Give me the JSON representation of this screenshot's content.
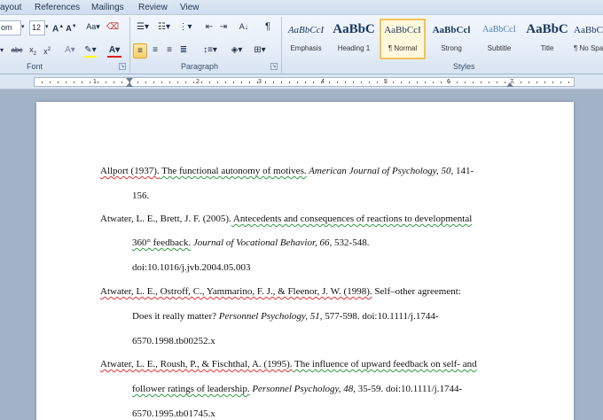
{
  "menu": {
    "tabs": [
      "ayout",
      "References",
      "Mailings",
      "Review",
      "View"
    ]
  },
  "ribbon": {
    "font": {
      "font_name": "om",
      "font_size": "12",
      "group_label": "Font"
    },
    "paragraph": {
      "group_label": "Paragraph"
    },
    "styles": {
      "group_label": "Styles",
      "items": [
        {
          "sample": "AaBbCcI",
          "name": "Emphasis"
        },
        {
          "sample": "AaBbC",
          "name": "Heading 1"
        },
        {
          "sample": "AaBbCcI",
          "name": "¶ Normal"
        },
        {
          "sample": "AaBbCcl",
          "name": "Strong"
        },
        {
          "sample": "AaBbCcI",
          "name": "Subtitle"
        },
        {
          "sample": "AaBbC",
          "name": "Title"
        },
        {
          "sample": "AaBbC",
          "name": "¶ No Spa"
        }
      ]
    }
  },
  "ruler": {
    "numbers": [
      "1",
      "2",
      "3",
      "4",
      "5",
      "6",
      "7"
    ]
  },
  "document": {
    "references": [
      {
        "lines": [
          [
            "Allport (1937).",
            " The functional autonomy of motives.",
            " American Journal of Psychology, 50,",
            " 141-"
          ],
          [
            "156."
          ]
        ]
      },
      {
        "lines": [
          [
            "Atwater, L. E., Brett, J. F. (2005).",
            " Antecedents and consequences of reactions to developmental"
          ],
          [
            "360° feedback.",
            " Journal of Vocational Behavior, 66,",
            " 532-548."
          ],
          [
            "doi:10.1016/j.jvb.2004.05.003"
          ]
        ]
      },
      {
        "lines": [
          [
            "Atwater, L. E., Ostroff, C., Yammarino, F. J., & Fleenor, J. W. (1998).",
            " Self–other agreement:"
          ],
          [
            "Does it really matter?",
            " Personnel Psychology, 51,",
            " 577-598. doi:10.1111/j.1744-"
          ],
          [
            "6570.1998.tb00252.x"
          ]
        ]
      },
      {
        "lines": [
          [
            "Atwater, L. E., Roush, P., & Fischthal, A. (1995).",
            " The influence of upward feedback on self- and"
          ],
          [
            "follower ratings of leadership.",
            " Personnel Psychology, 48,",
            " 35-59. doi:10.1111/j.1744-"
          ],
          [
            "6570.1995.tb01745.x"
          ]
        ]
      }
    ]
  }
}
